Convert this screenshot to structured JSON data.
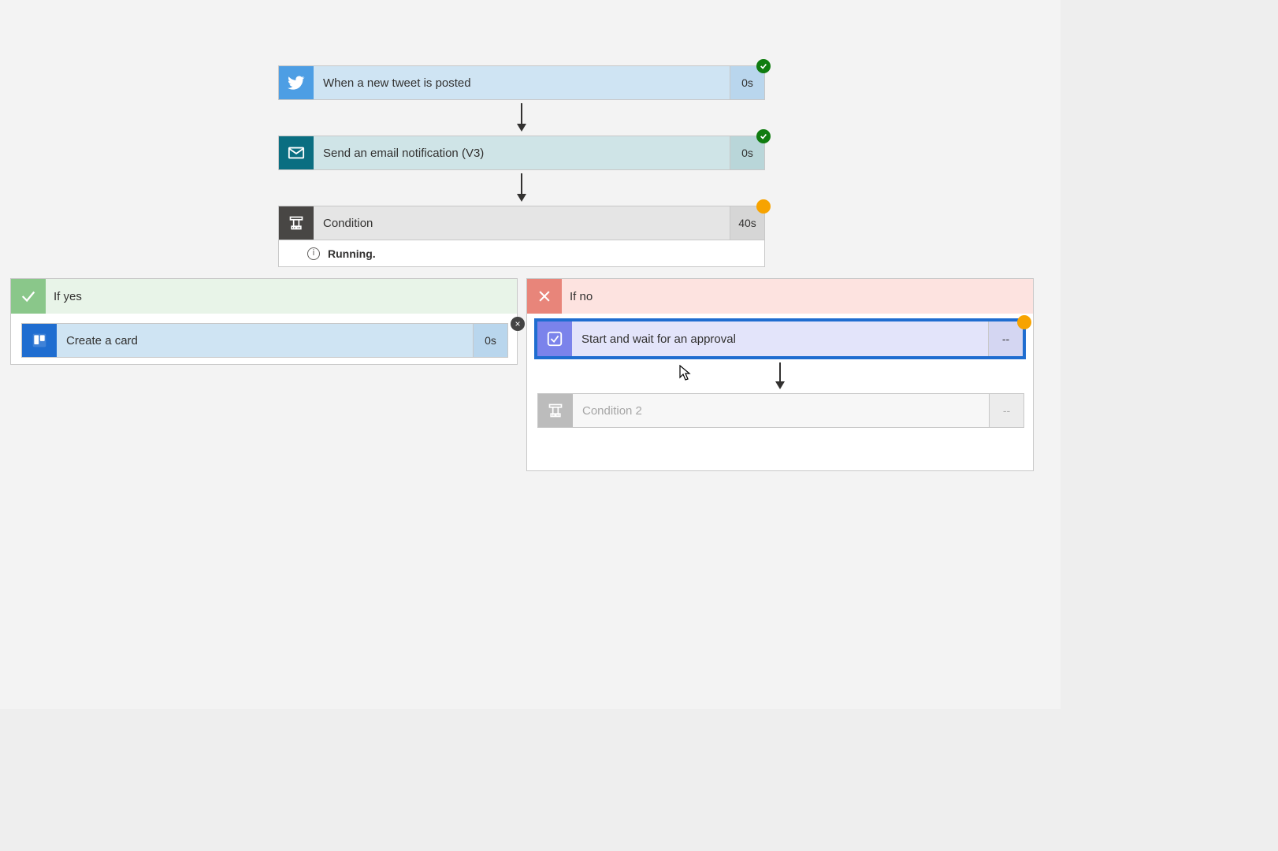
{
  "steps": {
    "trigger": {
      "label": "When a new tweet is posted",
      "duration": "0s"
    },
    "email": {
      "label": "Send an email notification (V3)",
      "duration": "0s"
    },
    "condition": {
      "label": "Condition",
      "duration": "40s",
      "status": "Running."
    }
  },
  "branches": {
    "yes": {
      "title": "If yes",
      "trello": {
        "label": "Create a card",
        "duration": "0s"
      }
    },
    "no": {
      "title": "If no",
      "approval": {
        "label": "Start and wait for an approval",
        "duration": "--"
      },
      "condition2": {
        "label": "Condition 2",
        "duration": "--"
      }
    }
  }
}
